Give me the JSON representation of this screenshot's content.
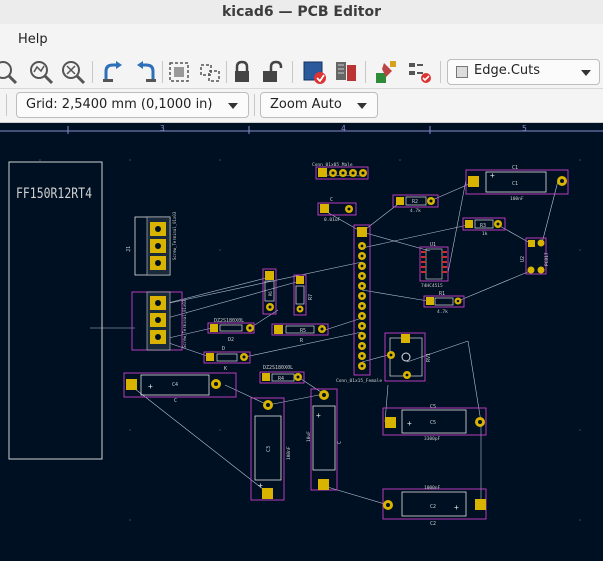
{
  "window": {
    "title": "kicad6 — PCB Editor"
  },
  "menubar": {
    "partial_item": "",
    "help": "Help"
  },
  "toolbar": {
    "icons": [
      "zoom-fit-icon",
      "zoom-in-icon",
      "zoom-out-icon",
      "zoom-selection-icon",
      "undo-icon",
      "redo-icon",
      "group-icon",
      "ungroup-icon",
      "lock-icon",
      "unlock-icon",
      "drc-icon",
      "netlist-icon",
      "scripting-icon",
      "board-setup-icon"
    ],
    "layer_select": "Edge.Cuts"
  },
  "toolbar2": {
    "grid": "Grid: 2,5400 mm (0,1000 in)",
    "zoom": "Zoom Auto"
  },
  "ruler": {
    "labels": [
      "3",
      "4",
      "5"
    ]
  },
  "board": {
    "big_label": "FF150R12RT4",
    "refs": {
      "c1": "C1",
      "c1_val": "100nF",
      "c_top": "C",
      "c_top_val": "0.01uF",
      "r2": "R2",
      "r2_val": "4.7k",
      "r3": "R3",
      "r3_val": "1k",
      "u1": "U1",
      "u1_val": "74HC4515",
      "u2": "U2",
      "u2_val": "PC817",
      "r1": "R1",
      "r1_val": "4.7k",
      "j1": "J1",
      "j1_val": "Screw_Terminal_01x03",
      "j2": "J2",
      "j2_val": "Screw_Terminal_01x03",
      "d2": "D2",
      "d2_val": "DZ2S180X0L",
      "d3": "D3",
      "d3_val": "DZ2S180X0L",
      "r5": "R5",
      "r4": "R4",
      "r4_val": "0k",
      "r6": "R6",
      "r6_val": "1k",
      "r7": "R7",
      "r7_val": "2k",
      "rv1": "RV1",
      "conn_top": "Conn_01x05_Male",
      "conn_side": "Conn_01x15_Female",
      "c4": "C4",
      "c4_v": "C",
      "c3": "C3",
      "c3_val": "100nF",
      "c_mid": "C",
      "c_mid_val": "10uF",
      "c5": "C5",
      "c5_val": "3300pF",
      "c2": "C2",
      "c2_val": "1000nF",
      "d_small": "D",
      "r_small": "R",
      "k_small": "K"
    }
  }
}
